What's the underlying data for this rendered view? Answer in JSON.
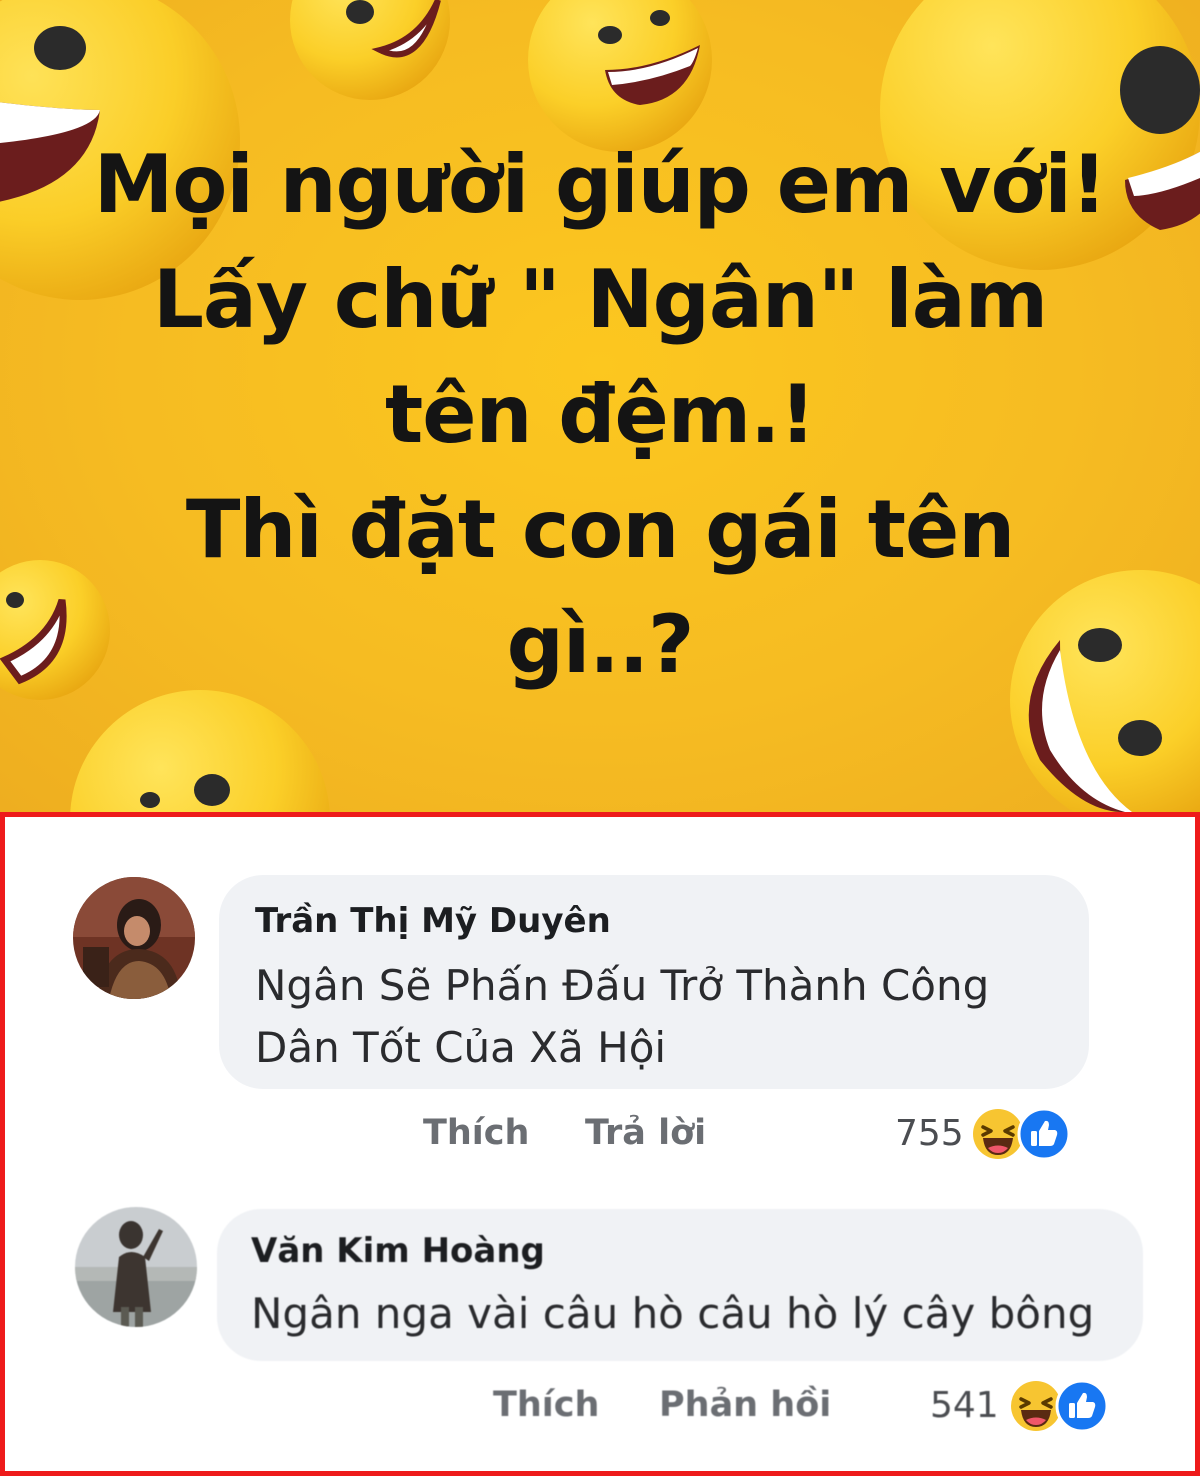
{
  "post": {
    "lines": [
      "Mọi người giúp em với!",
      "Lấy chữ \" Ngân\" làm",
      "tên đệm.!",
      "Thì đặt con gái tên",
      "gì..?"
    ],
    "background_color": "#f6bc22",
    "text_color": "#141414"
  },
  "comments": [
    {
      "author": "Trần Thị Mỹ Duyên",
      "text_lines": [
        "Ngân Sẽ Phấn Đấu Trở Thành Công",
        "Dân Tốt Của Xã Hội"
      ],
      "like_label": "Thích",
      "reply_label": "Trả lời",
      "reaction_count": "755",
      "reactions": [
        "haha-icon",
        "like-icon"
      ]
    },
    {
      "author": "Văn Kim Hoàng",
      "text_lines": [
        "Ngân nga vài câu hò câu hò lý cây bông"
      ],
      "like_label": "Thích",
      "reply_label": "Phản hồi",
      "reaction_count": "541",
      "reactions": [
        "haha-icon",
        "like-icon"
      ]
    }
  ],
  "colors": {
    "highlight_border": "#ee1b1b",
    "bubble": "#f0f2f5",
    "like_blue": "#1877f2",
    "haha_yellow": "#f7c531"
  }
}
